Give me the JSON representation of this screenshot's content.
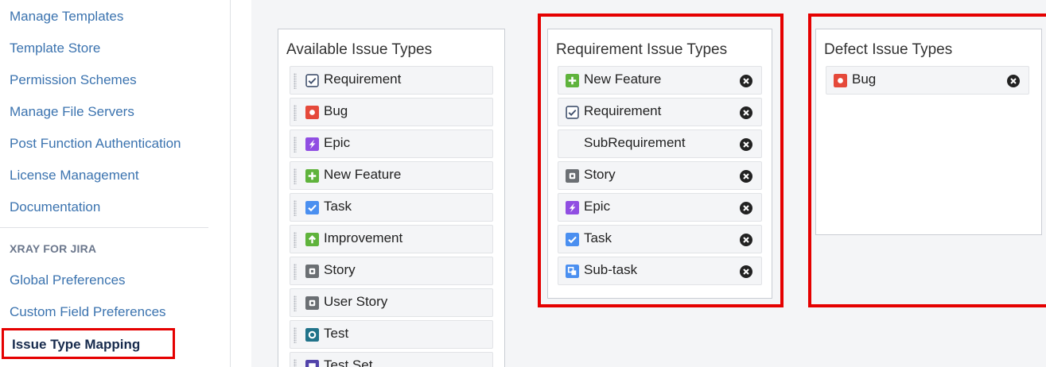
{
  "sidebar": {
    "links": [
      {
        "label": "Manage Templates"
      },
      {
        "label": "Template Store"
      },
      {
        "label": "Permission Schemes"
      },
      {
        "label": "Manage File Servers"
      },
      {
        "label": "Post Function Authentication"
      },
      {
        "label": "License Management"
      },
      {
        "label": "Documentation"
      }
    ],
    "section_heading": "XRAY FOR JIRA",
    "xray_links": [
      {
        "label": "Global Preferences"
      },
      {
        "label": "Custom Field Preferences"
      }
    ],
    "active_item": "Issue Type Mapping"
  },
  "available": {
    "title": "Available Issue Types",
    "items": [
      {
        "label": "Requirement",
        "icon": "requirement-icon"
      },
      {
        "label": "Bug",
        "icon": "bug-icon"
      },
      {
        "label": "Epic",
        "icon": "epic-icon"
      },
      {
        "label": "New Feature",
        "icon": "new-feature-icon"
      },
      {
        "label": "Task",
        "icon": "task-icon"
      },
      {
        "label": "Improvement",
        "icon": "improvement-icon"
      },
      {
        "label": "Story",
        "icon": "story-icon"
      },
      {
        "label": "User Story",
        "icon": "story-icon"
      },
      {
        "label": "Test",
        "icon": "test-icon"
      },
      {
        "label": "Test Set",
        "icon": "test-set-icon"
      }
    ]
  },
  "requirement": {
    "title": "Requirement Issue Types",
    "items": [
      {
        "label": "New Feature",
        "icon": "new-feature-icon"
      },
      {
        "label": "Requirement",
        "icon": "requirement-icon"
      },
      {
        "label": "SubRequirement",
        "icon": ""
      },
      {
        "label": "Story",
        "icon": "story-icon"
      },
      {
        "label": "Epic",
        "icon": "epic-icon"
      },
      {
        "label": "Task",
        "icon": "task-icon"
      },
      {
        "label": "Sub-task",
        "icon": "subtask-icon"
      }
    ]
  },
  "defect": {
    "title": "Defect Issue Types",
    "items": [
      {
        "label": "Bug",
        "icon": "bug-icon"
      }
    ]
  },
  "colors": {
    "link": "#3b73af",
    "highlight": "#e50000",
    "new_feature": "#5fb33c",
    "bug": "#e5493a",
    "epic": "#904ee2",
    "task": "#4a8ff0",
    "story_grey": "#6b6f73",
    "test_teal": "#21738a"
  }
}
